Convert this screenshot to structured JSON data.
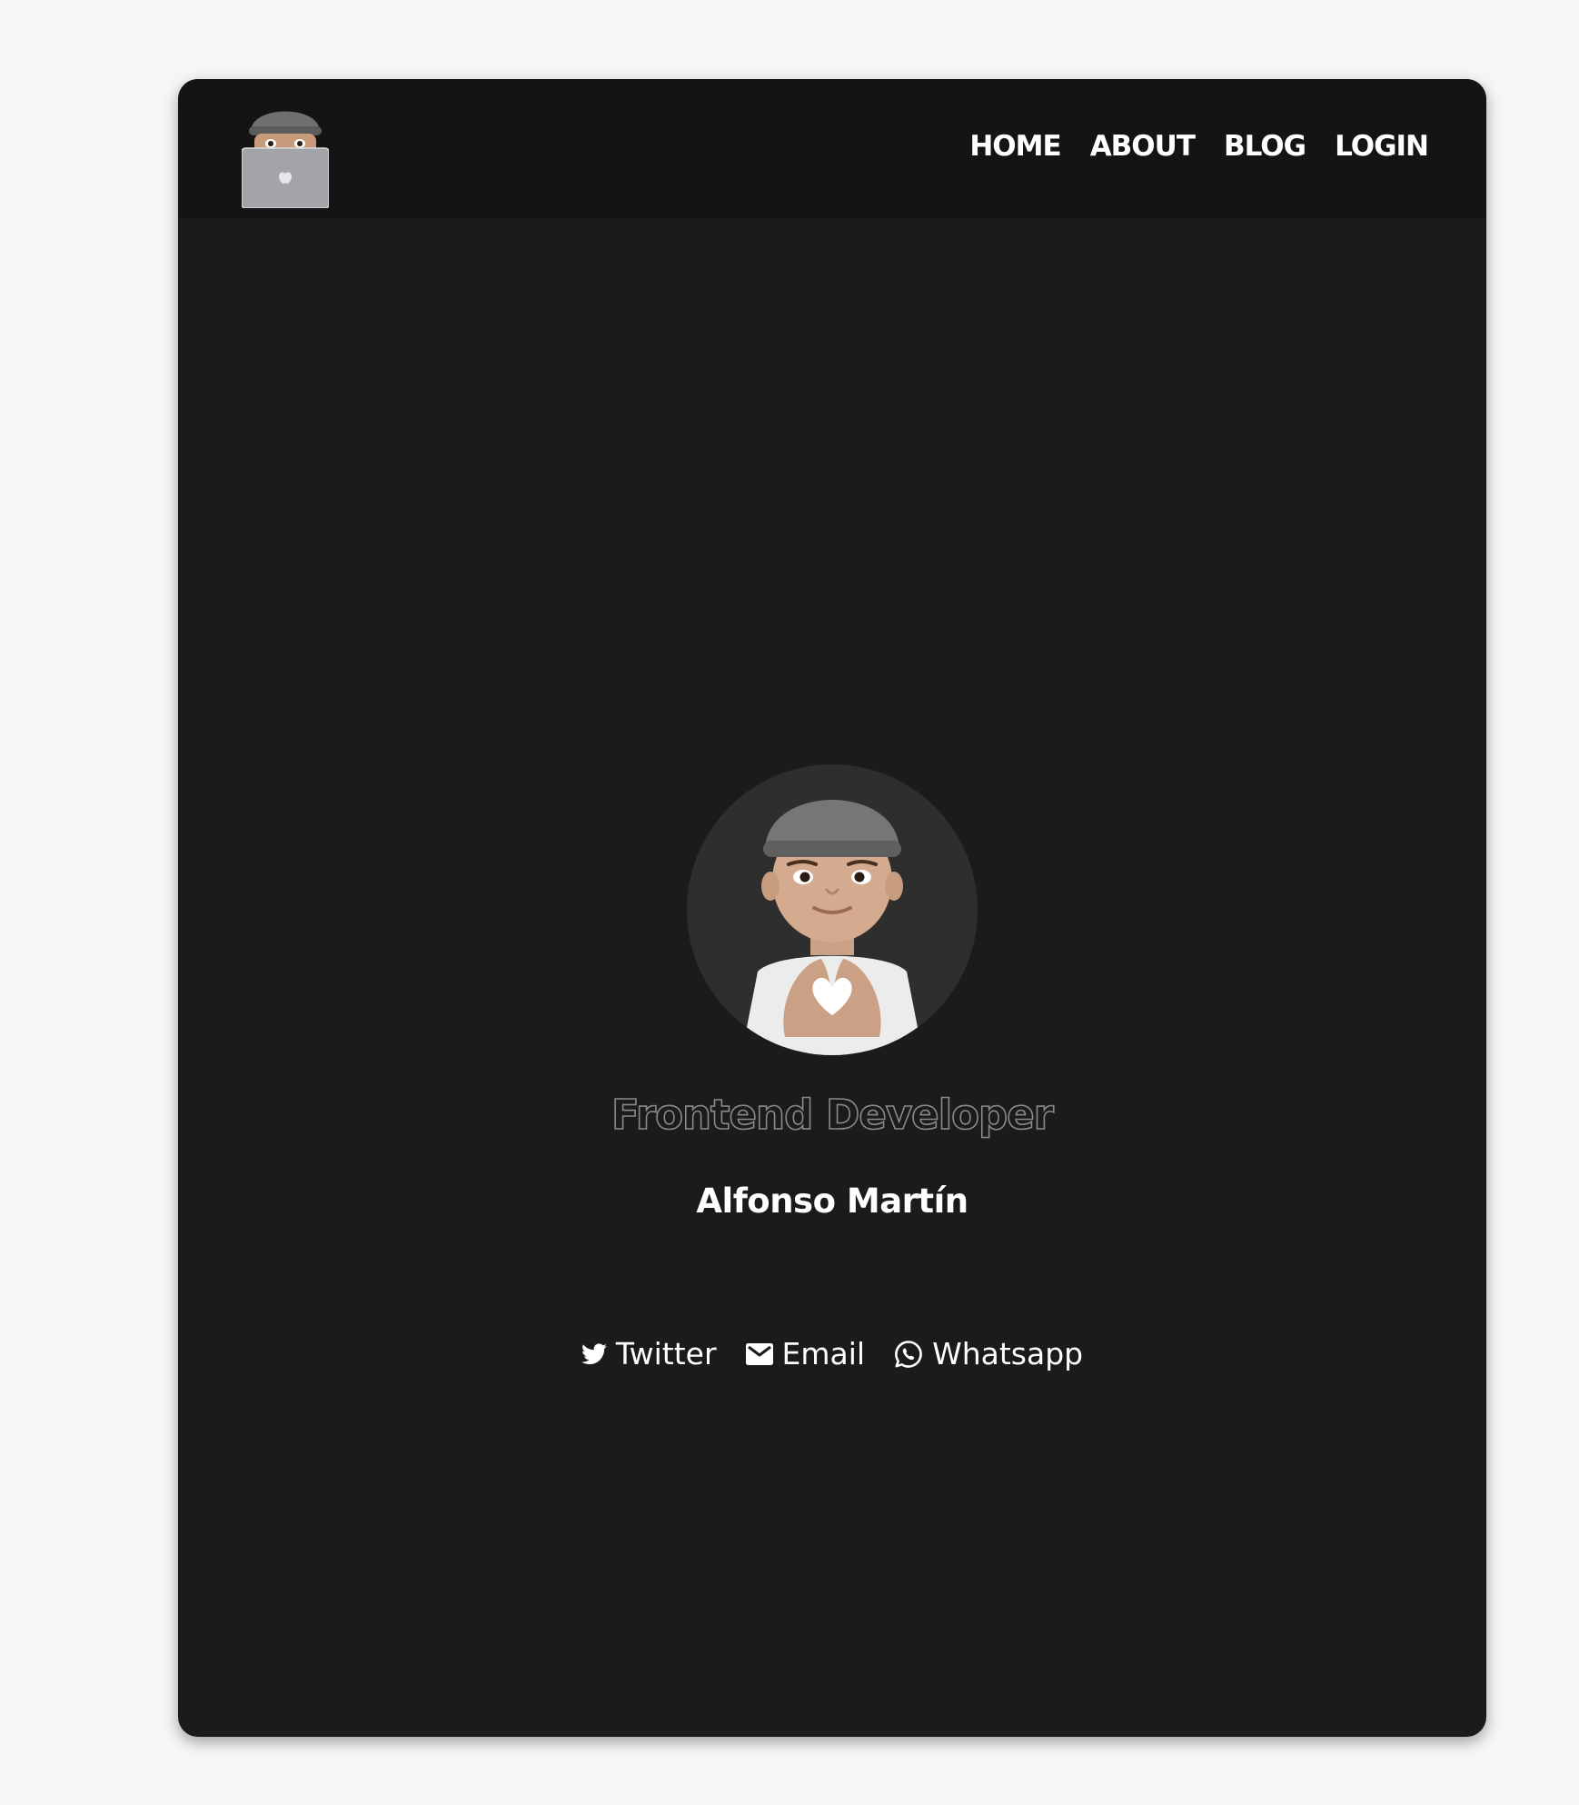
{
  "header": {
    "logo_icon": "memoji-laptop-icon",
    "nav": [
      {
        "label": "HOME"
      },
      {
        "label": "ABOUT"
      },
      {
        "label": "BLOG"
      },
      {
        "label": "LOGIN"
      }
    ]
  },
  "profile": {
    "avatar_icon": "memoji-heart-hands-avatar",
    "role": "Frontend Developer",
    "name": "Alfonso Martín"
  },
  "socials": [
    {
      "label": "Twitter",
      "icon": "twitter-icon"
    },
    {
      "label": "Email",
      "icon": "email-icon"
    },
    {
      "label": "Whatsapp",
      "icon": "whatsapp-icon"
    }
  ],
  "colors": {
    "page_bg": "#f6f6f6",
    "card_bg": "#1b1b1b",
    "header_bg": "#141414",
    "avatar_bg": "#2e2e2e",
    "text": "#ffffff",
    "outline_text": "#8a8a8a"
  }
}
